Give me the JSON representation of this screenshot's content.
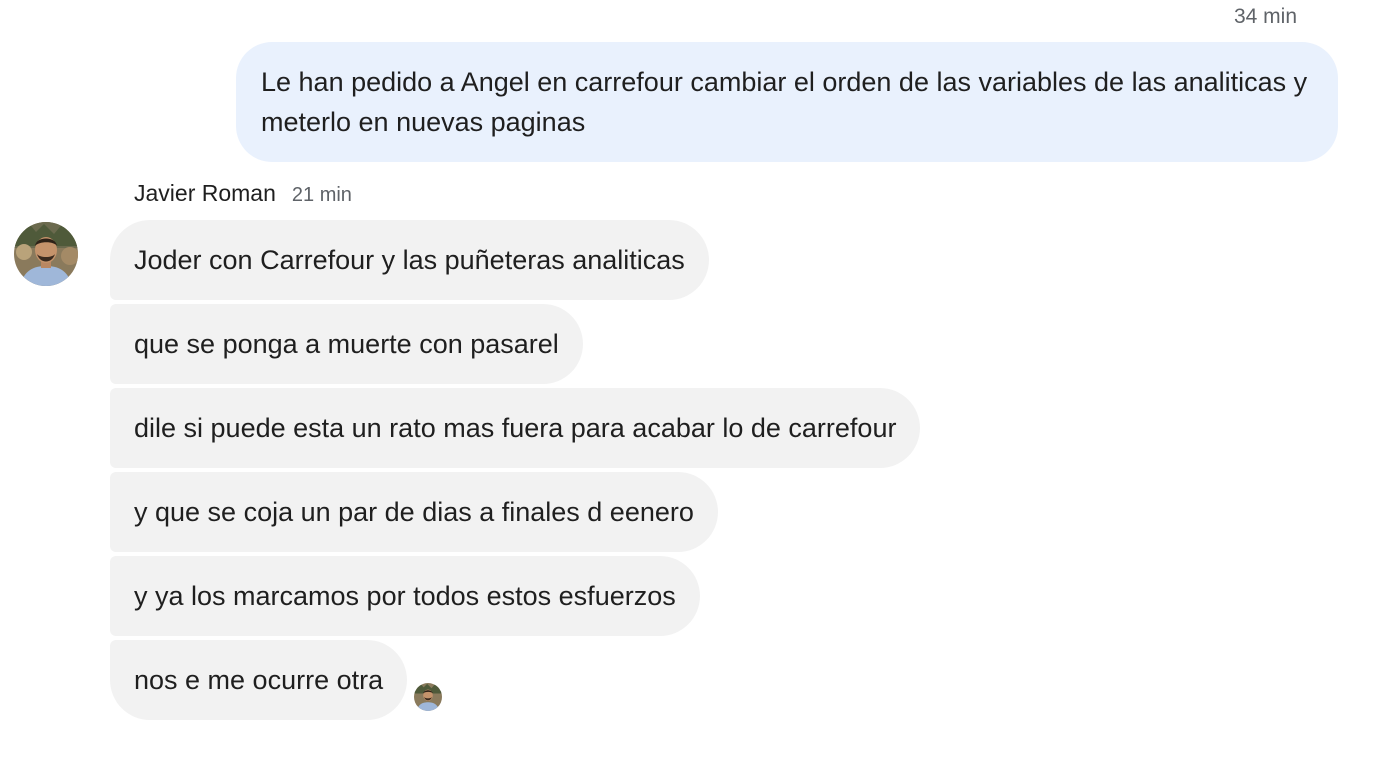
{
  "outgoing": {
    "time": "34 min",
    "text": "Le han pedido a Angel en carrefour cambiar el orden de las variables de las analiticas y meterlo en nuevas paginas"
  },
  "incoming": {
    "sender": "Javier Roman",
    "time": "21 min",
    "messages": [
      "Joder con Carrefour y las puñeteras analiticas",
      "que se ponga a muerte con pasarel",
      "dile si puede esta un rato mas fuera para acabar lo de carrefour",
      "y que se coja un par de dias a finales d eenero",
      "y ya los marcamos por todos estos esfuerzos",
      "nos e me ocurre otra"
    ]
  },
  "colors": {
    "outgoing_bubble": "#e9f1fd",
    "incoming_bubble": "#f2f2f2",
    "timestamp": "#5f6368",
    "text": "#1f1f1f"
  },
  "icons": {
    "avatar": "user-avatar-icon",
    "read_receipt": "read-receipt-avatar-icon"
  }
}
